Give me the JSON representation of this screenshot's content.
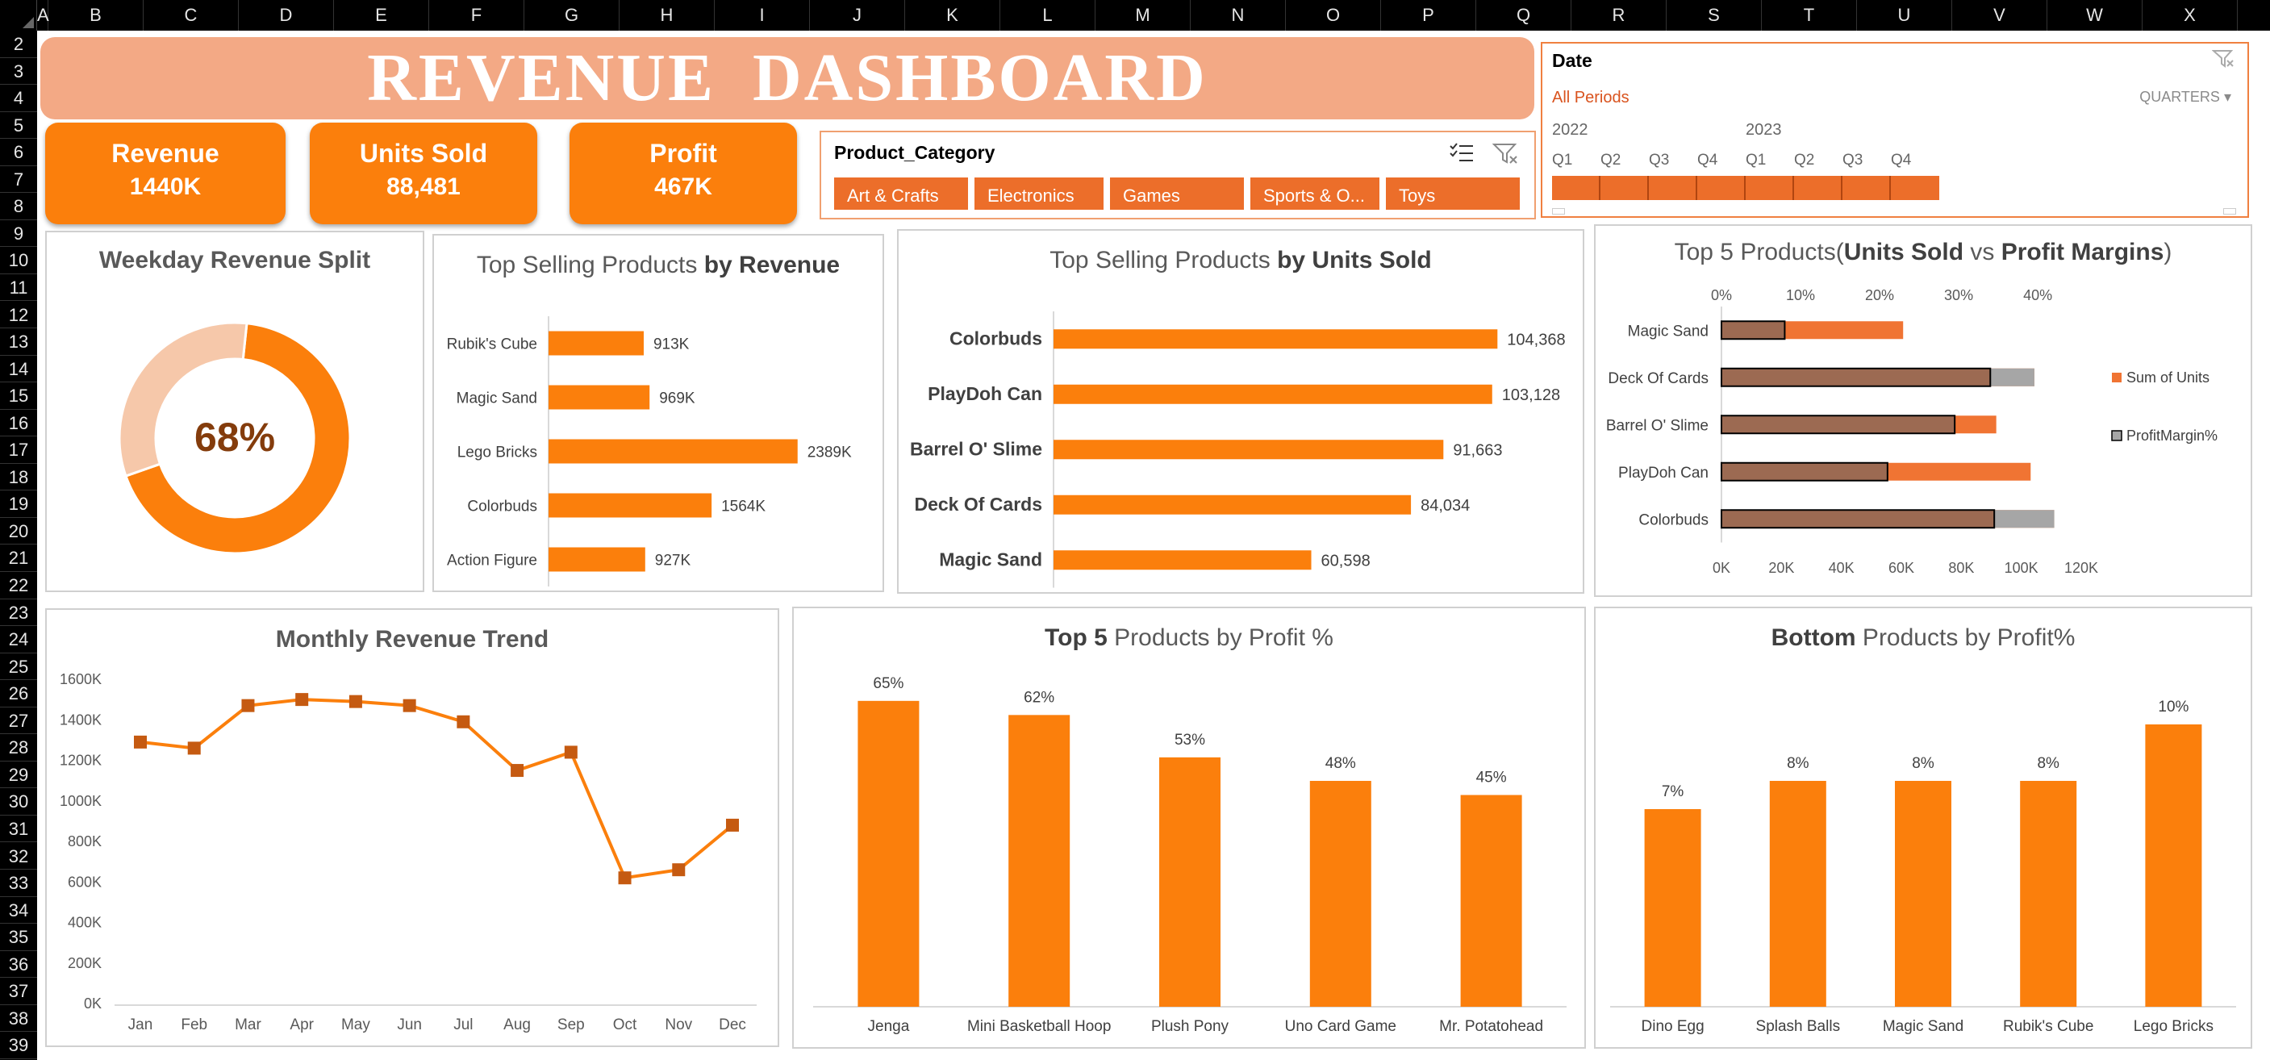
{
  "spreadsheet": {
    "columns": [
      "A",
      "B",
      "C",
      "D",
      "E",
      "F",
      "G",
      "H",
      "I",
      "J",
      "K",
      "L",
      "M",
      "N",
      "O",
      "P",
      "Q",
      "R",
      "S",
      "T",
      "U",
      "V",
      "W",
      "X"
    ],
    "rows": [
      "2",
      "3",
      "4",
      "5",
      "6",
      "7",
      "8",
      "9",
      "10",
      "11",
      "12",
      "13",
      "14",
      "15",
      "16",
      "17",
      "18",
      "19",
      "20",
      "21",
      "22",
      "23",
      "24",
      "25",
      "26",
      "27",
      "28",
      "29",
      "30",
      "31",
      "32",
      "33",
      "34",
      "35",
      "36",
      "37",
      "38",
      "39"
    ]
  },
  "dashboard": {
    "title": "REVENUE  DASHBOARD"
  },
  "kpis": [
    {
      "label": "Revenue",
      "value": "1440K"
    },
    {
      "label": "Units Sold",
      "value": "88,481"
    },
    {
      "label": "Profit",
      "value": "467K"
    }
  ],
  "category_slicer": {
    "header": "Product_Category",
    "items": [
      "Art & Crafts",
      "Electronics",
      "Games",
      "Sports & O...",
      "Toys"
    ]
  },
  "date_timeline": {
    "header": "Date",
    "period": "All Periods",
    "level": "QUARTERS",
    "years": [
      "2022",
      "2023"
    ],
    "quarters": [
      "Q1",
      "Q2",
      "Q3",
      "Q4",
      "Q1",
      "Q2",
      "Q3",
      "Q4"
    ]
  },
  "colors": {
    "accent": "#fb7f0c",
    "dark_orange": "#ec6e2a",
    "marker": "#c55a11",
    "banner": "#f3a985",
    "donut_light": "#f6c8aa",
    "brown": "#9c6a52",
    "grey": "#a6a6a6"
  },
  "charts": {
    "weekday": {
      "title": "Weekday Revenue Split",
      "center_label": "68%",
      "chart_data": {
        "type": "pie",
        "values": [
          68,
          32
        ]
      }
    },
    "top_revenue": {
      "title_normal": "Top Selling Products ",
      "title_bold": "by Revenue",
      "chart_data": {
        "type": "bar",
        "orientation": "horizontal",
        "categories": [
          "Rubik's Cube",
          "Magic Sand",
          "Lego Bricks",
          "Colorbuds",
          "Action Figure"
        ],
        "values": [
          913,
          969,
          2389,
          1564,
          927
        ],
        "labels": [
          "913K",
          "969K",
          "2389K",
          "1564K",
          "927K"
        ],
        "xlim": [
          0,
          2600
        ]
      }
    },
    "top_units": {
      "title_normal": "Top Selling Products ",
      "title_bold": "by Units Sold",
      "chart_data": {
        "type": "bar",
        "orientation": "horizontal",
        "categories": [
          "Colorbuds",
          "PlayDoh Can",
          "Barrel O' Slime",
          "Deck Of Cards",
          "Magic Sand"
        ],
        "values": [
          104368,
          103128,
          91663,
          84034,
          60598
        ],
        "labels": [
          "104,368",
          "103,128",
          "91,663",
          "84,034",
          "60,598"
        ],
        "xlim": [
          0,
          110000
        ]
      }
    },
    "units_vs_margin": {
      "title_normal": "Top 5 Products(",
      "title_bold1": "Units Sold",
      "title_mid": " vs ",
      "title_bold2": "Profit Margins",
      "title_end": ")",
      "chart_data": {
        "type": "bar",
        "orientation": "horizontal",
        "categories": [
          "Magic Sand",
          "Deck Of Cards",
          "Barrel O' Slime",
          "PlayDoh Can",
          "Colorbuds"
        ],
        "series": [
          {
            "name": "Sum of Units",
            "values": [
              60598,
              104368,
              91663,
              103128,
              111000
            ]
          },
          {
            "name": "ProfitMargin%",
            "values": [
              8,
              34,
              29.5,
              21,
              34.5
            ]
          }
        ],
        "x_ticks": [
          "0K",
          "20K",
          "40K",
          "60K",
          "80K",
          "100K",
          "120K"
        ],
        "x2_ticks": [
          "0%",
          "10%",
          "20%",
          "30%",
          "40%"
        ],
        "xlim": [
          0,
          120000
        ],
        "x2lim": [
          0,
          40
        ]
      }
    },
    "monthly": {
      "title": "Monthly Revenue Trend",
      "chart_data": {
        "type": "line",
        "categories": [
          "Jan",
          "Feb",
          "Mar",
          "Apr",
          "May",
          "Jun",
          "Jul",
          "Aug",
          "Sep",
          "Oct",
          "Nov",
          "Dec"
        ],
        "values": [
          1290,
          1260,
          1470,
          1500,
          1490,
          1470,
          1390,
          1150,
          1240,
          620,
          660,
          880
        ],
        "y_ticks": [
          "0K",
          "200K",
          "400K",
          "600K",
          "800K",
          "1000K",
          "1200K",
          "1400K",
          "1600K"
        ],
        "ylim": [
          0,
          1600
        ]
      }
    },
    "top_profit": {
      "title_bold": "Top 5",
      "title_normal": " Products by Profit %",
      "chart_data": {
        "type": "bar",
        "categories": [
          "Jenga",
          "Mini Basketball Hoop",
          "Plush Pony",
          "Uno Card Game",
          "Mr. Potatohead"
        ],
        "values": [
          65,
          62,
          53,
          48,
          45
        ],
        "labels": [
          "65%",
          "62%",
          "53%",
          "48%",
          "45%"
        ],
        "ylim": [
          0,
          72
        ]
      }
    },
    "bottom_profit": {
      "title_bold": "Bottom",
      "title_normal": "  Products by Profit%",
      "chart_data": {
        "type": "bar",
        "categories": [
          "Dino Egg",
          "Splash Balls",
          "Magic Sand",
          "Rubik's Cube",
          "Lego Bricks"
        ],
        "values": [
          7,
          8,
          8,
          8,
          10
        ],
        "labels": [
          "7%",
          "8%",
          "8%",
          "8%",
          "10%"
        ],
        "ylim": [
          0,
          12
        ]
      }
    }
  }
}
